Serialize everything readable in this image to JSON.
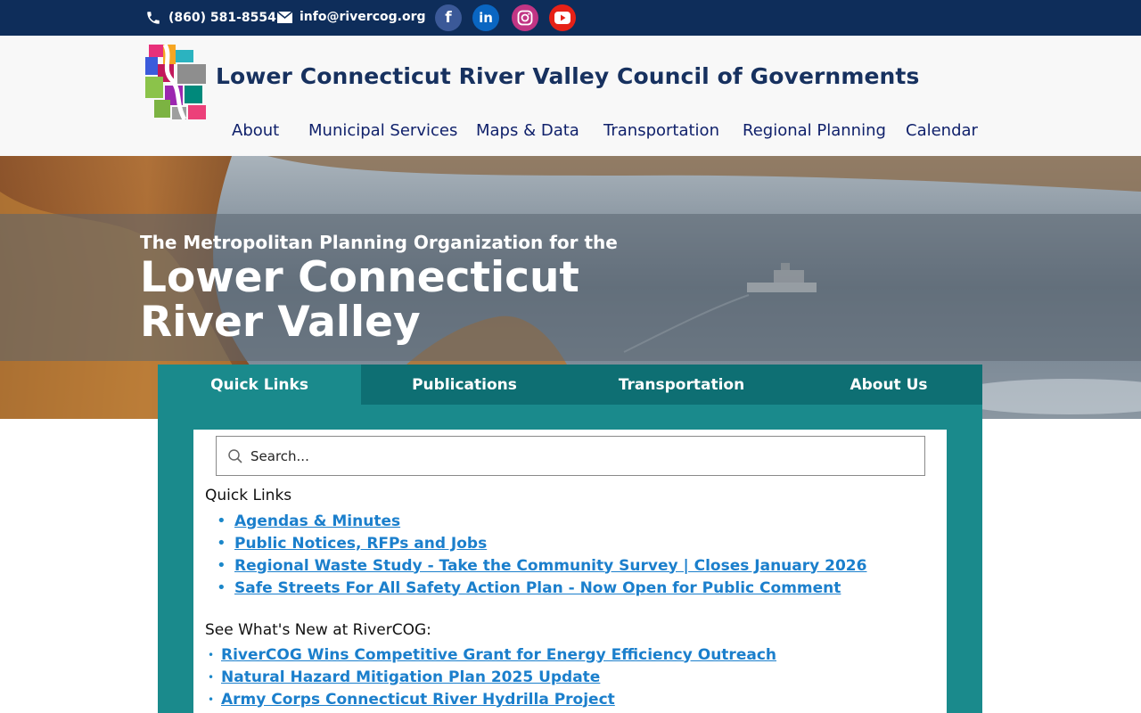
{
  "topbar": {
    "phone": "(860) 581-8554",
    "email": "info@rivercog.org",
    "social": [
      {
        "icon": "facebook-icon",
        "glyph": "f"
      },
      {
        "icon": "linkedin-icon",
        "glyph": "in"
      },
      {
        "icon": "instagram-icon",
        "glyph": ""
      },
      {
        "icon": "youtube-icon",
        "glyph": ""
      }
    ]
  },
  "header": {
    "title": "Lower Connecticut River Valley Council of Governments",
    "nav": [
      "About",
      "Municipal Services",
      "Maps & Data",
      "Transportation",
      "Regional Planning",
      "Calendar"
    ]
  },
  "hero": {
    "subtitle": "The Metropolitan Planning Organization for the",
    "title": "Lower Connecticut River Valley"
  },
  "tabs": {
    "items": [
      "Quick Links",
      "Publications",
      "Transportation",
      "About Us"
    ],
    "active": "Quick Links"
  },
  "content": {
    "search_placeholder": "Search...",
    "quick_links_heading": "Quick Links",
    "quick_links": [
      "Agendas & Minutes",
      "Public Notices, RFPs and Jobs",
      "Regional Waste Study - Take the Community Survey | Closes January 2026",
      "Safe Streets For All Safety Action Plan - Now Open for Public Comment"
    ],
    "news_heading": "See What's New at RiverCOG:",
    "news": [
      "RiverCOG Wins Competitive Grant for Energy Efficiency Outreach",
      "Natural Hazard Mitigation Plan 2025 Update",
      "Army Corps Connecticut River Hydrilla Project"
    ]
  },
  "colors": {
    "topbar": "#0e2d5a",
    "title": "#17315f",
    "nav": "#10216b",
    "panel": "#1a8a8c",
    "tabs": "#0e6f73",
    "link": "#1b7fcc"
  }
}
